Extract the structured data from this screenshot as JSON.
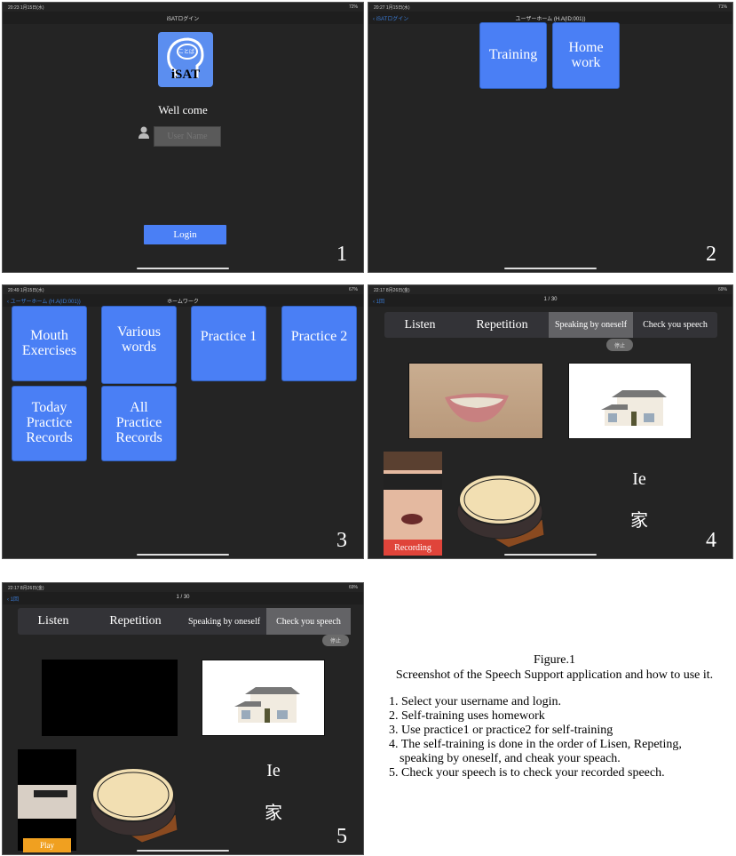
{
  "panels": [
    {
      "number": "1",
      "status": {
        "time": "20:23  1月15日(水)",
        "battery": "72%"
      },
      "nav_title": "iSATログイン",
      "logo": {
        "bubble_text": "ことば",
        "name": "iSAT"
      },
      "welcome": "Well come",
      "username_placeholder": "User Name",
      "login_label": "Login"
    },
    {
      "number": "2",
      "status": {
        "time": "20:27  1月15日(水)",
        "battery": "71%"
      },
      "nav_back": "iSATログイン",
      "nav_title": "ユーザーホーム (H.A(ID:001))",
      "tiles": [
        "Training",
        "Home\nwork"
      ]
    },
    {
      "number": "3",
      "status": {
        "time": "20:49  1月15日(水)",
        "battery": "67%"
      },
      "nav_back": "ユーザーホーム (H.A(ID:001))",
      "nav_title": "ホームワーク",
      "tiles": [
        "Mouth\nExercises",
        "Various\nwords",
        "Practice 1",
        "Practice 2",
        "Today\nPractice\nRecords",
        "All\nPractice\nRecords"
      ]
    },
    {
      "number": "4",
      "status": {
        "time": "22:17  8月26日(金)",
        "battery": "69%"
      },
      "nav_back": "1回",
      "nav_title": "1 / 30",
      "segments": [
        "Listen",
        "Repetition",
        "Speaking by oneself",
        "Check you speech"
      ],
      "active_segment": "Speaking by oneself",
      "stop_label": "停止",
      "camera_button": "Recording",
      "word_romaji": "Ie",
      "word_kanji": "家"
    },
    {
      "number": "5",
      "status": {
        "time": "22:17  8月26日(金)",
        "battery": "69%"
      },
      "nav_back": "1回",
      "nav_title": "1 / 30",
      "segments": [
        "Listen",
        "Repetition",
        "Speaking by oneself",
        "Check you speech"
      ],
      "active_segment": "Check you speech",
      "stop_label": "停止",
      "camera_button": "Play",
      "word_romaji": "Ie",
      "word_kanji": "家"
    }
  ],
  "caption": {
    "title": "Figure.1",
    "subtitle": "Screenshot of the Speech Support application and how to use it.",
    "steps": [
      "1. Select your username and login.",
      "2. Self-training uses homework",
      "3. Use practice1 or practice2 for self-training",
      "4. The self-training is done in the order of Lisen, Repeting,",
      "speaking by oneself, and cheak your speach.",
      "5. Check your speech is to check your recorded speech."
    ]
  },
  "colors": {
    "accent": "#4a7ff5",
    "record": "#e0443a",
    "play": "#f0a020",
    "background": "#242424"
  }
}
